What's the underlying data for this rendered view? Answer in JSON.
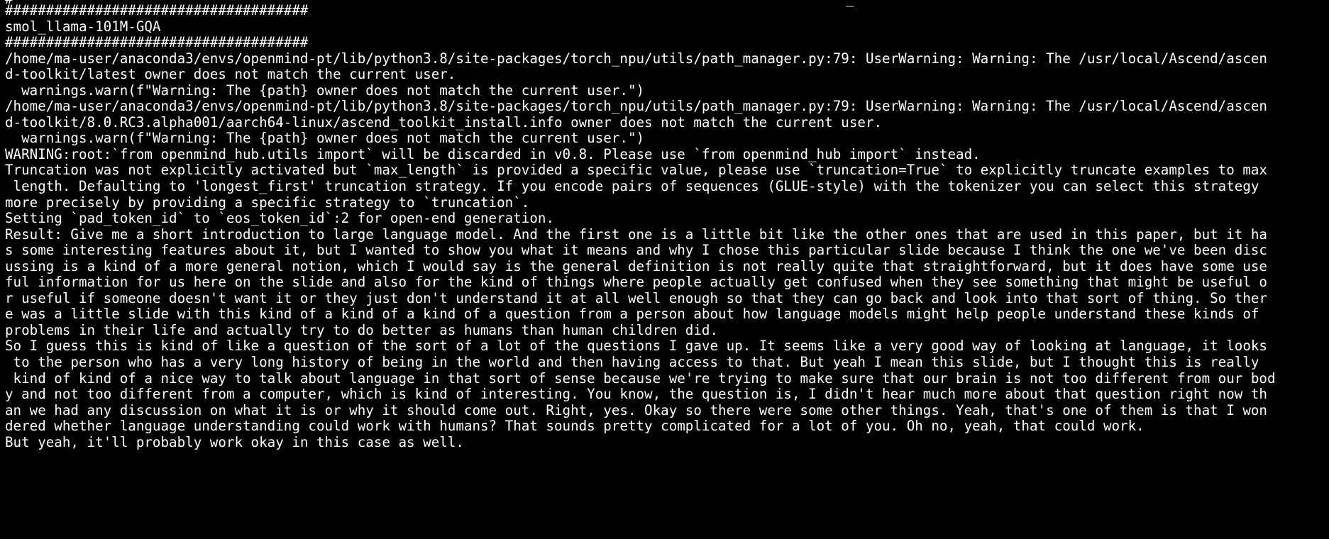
{
  "terminal": {
    "clipped_top_fragments": [
      "#",
      "_"
    ],
    "lines": [
      "#####################################",
      "smol_llama-101M-GQA",
      "#####################################",
      "/home/ma-user/anaconda3/envs/openmind-pt/lib/python3.8/site-packages/torch_npu/utils/path_manager.py:79: UserWarning: Warning: The /usr/local/Ascend/ascen",
      "d-toolkit/latest owner does not match the current user.",
      "  warnings.warn(f\"Warning: The {path} owner does not match the current user.\")",
      "/home/ma-user/anaconda3/envs/openmind-pt/lib/python3.8/site-packages/torch_npu/utils/path_manager.py:79: UserWarning: Warning: The /usr/local/Ascend/ascen",
      "d-toolkit/8.0.RC3.alpha001/aarch64-linux/ascend_toolkit_install.info owner does not match the current user.",
      "  warnings.warn(f\"Warning: The {path} owner does not match the current user.\")",
      "WARNING:root:`from openmind_hub.utils import` will be discarded in v0.8. Please use `from openmind_hub import` instead.",
      "Truncation was not explicitly activated but `max_length` is provided a specific value, please use `truncation=True` to explicitly truncate examples to max",
      " length. Defaulting to 'longest_first' truncation strategy. If you encode pairs of sequences (GLUE-style) with the tokenizer you can select this strategy",
      "more precisely by providing a specific strategy to `truncation`.",
      "Setting `pad_token_id` to `eos_token_id`:2 for open-end generation.",
      "Result: Give me a short introduction to large language model. And the first one is a little bit like the other ones that are used in this paper, but it ha",
      "s some interesting features about it, but I wanted to show you what it means and why I chose this particular slide because I think the one we've been disc",
      "ussing is a kind of a more general notion, which I would say is the general definition is not really quite that straightforward, but it does have some use",
      "ful information for us here on the slide and also for the kind of things where people actually get confused when they see something that might be useful o",
      "r useful if someone doesn't want it or they just don't understand it at all well enough so that they can go back and look into that sort of thing. So ther",
      "e was a little slide with this kind of a kind of a kind of a question from a person about how language models might help people understand these kinds of",
      "problems in their life and actually try to do better as humans than human children did.",
      "So I guess this is kind of like a question of the sort of a lot of the questions I gave up. It seems like a very good way of looking at language, it looks",
      " to the person who has a very long history of being in the world and then having access to that. But yeah I mean this slide, but I thought this is really",
      " kind of kind of a nice way to talk about language in that sort of sense because we're trying to make sure that our brain is not too different from our bod",
      "y and not too different from a computer, which is kind of interesting. You know, the question is, I didn't hear much more about that question right now th",
      "an we had any discussion on what it is or why it should come out. Right, yes. Okay so there were some other things. Yeah, that's one of them is that I won",
      "dered whether language understanding could work with humans? That sounds pretty complicated for a lot of you. Oh no, yeah, that could work.",
      "But yeah, it'll probably work okay in this case as well."
    ]
  }
}
